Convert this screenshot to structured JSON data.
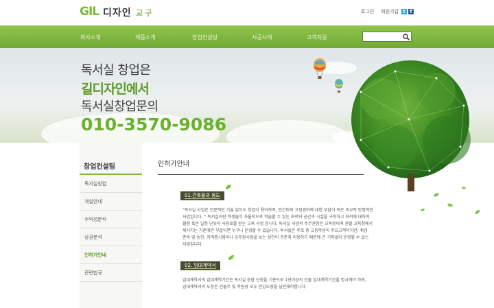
{
  "header": {
    "logo_mark": "GIL",
    "logo_title": "디자인",
    "logo_sub": "교구",
    "login_label": "로그인",
    "join_label": "회원가입",
    "twitter_icon": "t",
    "facebook_icon": "f"
  },
  "nav": {
    "items": [
      {
        "label": "회사소개"
      },
      {
        "label": "제품소개"
      },
      {
        "label": "창업컨설팅"
      },
      {
        "label": "시공사례"
      },
      {
        "label": "고객지원"
      }
    ],
    "search_placeholder": ""
  },
  "banner": {
    "line1": "독서실 창업은",
    "line2": "길디자인에서",
    "line3": "독서실창업문의",
    "phone": "010-3570-9086"
  },
  "sidebar": {
    "title": "창업컨설팅",
    "items": [
      {
        "label": "독서실창업"
      },
      {
        "label": "개설안내"
      },
      {
        "label": "수익성분석"
      },
      {
        "label": "상권분석"
      },
      {
        "label": "인허가안내"
      },
      {
        "label": "관련법규"
      }
    ],
    "active_index": 4
  },
  "content": {
    "page_title": "인허가안내",
    "section1_label": "01.건축물의 용도",
    "section1_lines": [
      "\"독서실 사업은 전문적인 기술 없이도 창업이 용이하며, 인건비와 고정경비에 대한 부담이 적은 비교적 안정적인",
      "사업입니다. \" 독서실이란 학생들이 자율적으로 학습할 수 있는 최적의 공간과 시설을 구비하고 좌석에 대하여",
      "월정 혹은 일정 단위의 사용료를 받는 교육 사업 입니다. 독서실 사업의 주무관청은 교육청이며 관할 교육청에서",
      "제시하는 기준에만 부합되면 누구나 운영할 수 있습니다. 독서실은 주로 중 고등학생이 주요고객이지만, 취업",
      "준비 및 승진, 자격증시험이나 공무원시험을 보는 성인이 꾸준히 이용하기 때문에 큰 기복없이 운영할 수 있는",
      "사업입니다."
    ],
    "section2_label": "02. 임대계약서",
    "section2_lines": [
      "임대계약서의 임대계약기간은 독서실 승합 신청을 기준으로 1년이상의 건물 임대계약기간을 명시해야 하며,",
      "임대계약서의 도장은 건물주 및 학원장 모두 인감도장을 날인해야합니다."
    ]
  },
  "colors": {
    "brand_green": "#7cb93a",
    "nav_green": "#72a935",
    "label_dark": "#4c4c32"
  },
  "icons": {
    "search": "magnifier",
    "leaf": "leaf",
    "balloon": "hot-air-balloon",
    "twitter": "twitter",
    "facebook": "facebook"
  }
}
